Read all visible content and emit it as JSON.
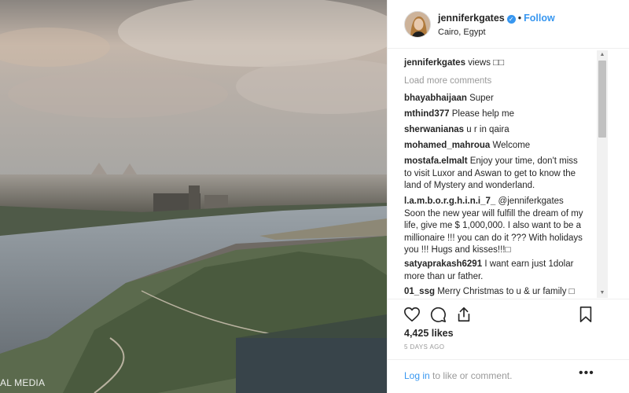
{
  "watermark": "AL MEDIA",
  "post": {
    "username": "jenniferkgates",
    "verified_glyph": "✓",
    "separator": "•",
    "follow_label": "Follow",
    "location": "Cairo, Egypt"
  },
  "caption": {
    "username": "jenniferkgates",
    "text": "views □□"
  },
  "load_more_label": "Load more comments",
  "comments": [
    {
      "username": "bhayabhaijaan",
      "text": "Super"
    },
    {
      "username": "mthind377",
      "text": "Please help me"
    },
    {
      "username": "sherwanianas",
      "text": "u r in qaira"
    },
    {
      "username": "mohamed_mahroua",
      "text": "Welcome"
    },
    {
      "username": "mostafa.elmalt",
      "text": "Enjoy your time, don't miss to visit Luxor and Aswan to get to know the land of Mystery and wonderland."
    },
    {
      "username": "l.a.m.b.o.r.g.h.i.n.i_7_",
      "text": "@jenniferkgates Soon the new year will fulfill the dream of my life, give me $ 1,000,000. I also want to be a millionaire !!! you can do it ??? With holidays you !!! Hugs and kisses!!!□"
    },
    {
      "username": "satyaprakash6291",
      "text": "I want earn just 1dolar more than ur father."
    },
    {
      "username": "01_ssg",
      "text": "Merry Christmas to u & ur family □"
    }
  ],
  "icons": {
    "like": "heart-icon",
    "comment": "comment-icon",
    "share": "share-icon",
    "save": "bookmark-icon",
    "more": "more-options-icon"
  },
  "likes_label": "4,425 likes",
  "timestamp": "5 DAYS AGO",
  "footer": {
    "login_label": "Log in",
    "suffix": " to like or comment.",
    "more_glyph": "•••"
  },
  "colors": {
    "accent": "#3897f0",
    "muted": "#999999",
    "text": "#262626"
  }
}
